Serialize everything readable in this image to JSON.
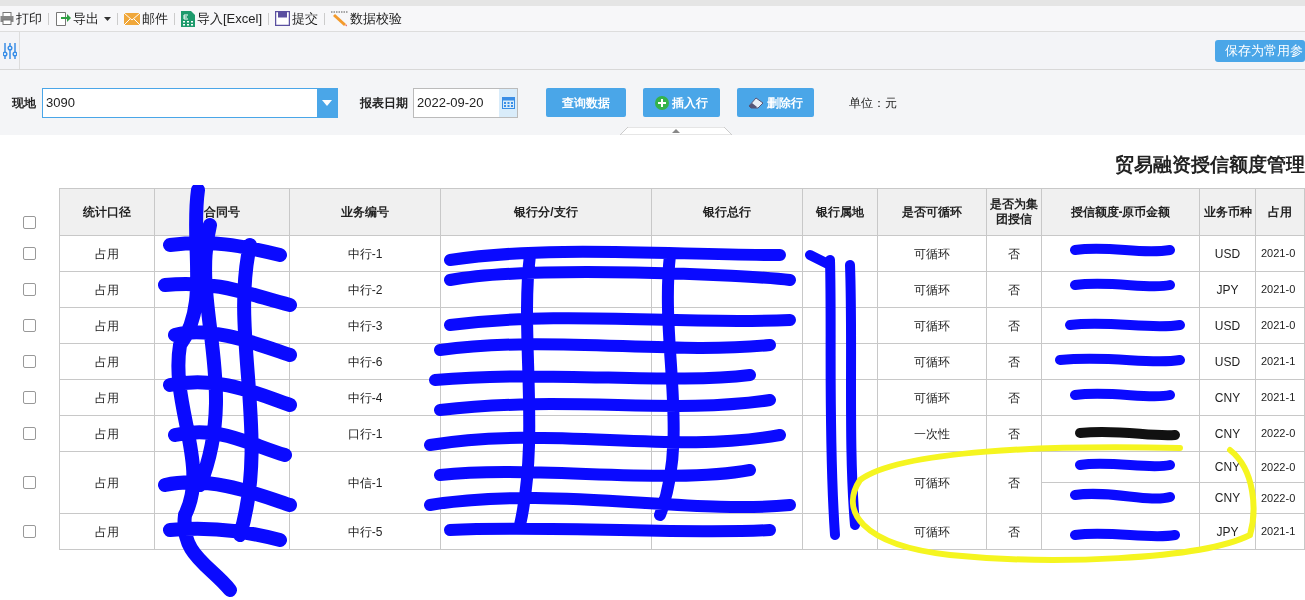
{
  "toolbar": [
    {
      "kind": "print",
      "label": "打印",
      "caret": false
    },
    {
      "kind": "export",
      "label": "导出",
      "caret": true
    },
    {
      "kind": "mail",
      "label": "邮件",
      "caret": false
    },
    {
      "kind": "excel",
      "label": "导入[Excel]",
      "caret": false
    },
    {
      "kind": "submit",
      "label": "提交",
      "caret": false
    },
    {
      "kind": "validate",
      "label": "数据校验",
      "caret": false
    }
  ],
  "save_button": "保存为常用参",
  "filters": {
    "location": {
      "label": "现地",
      "value": "3090"
    },
    "report_date": {
      "label": "报表日期",
      "value": "2022-09-20"
    },
    "buttons": [
      {
        "kind": "plain",
        "label": "查询数据"
      },
      {
        "kind": "insert",
        "label": "插入行"
      },
      {
        "kind": "delete",
        "label": "删除行"
      }
    ],
    "unit": "单位：元"
  },
  "title": "贸易融资授信额度管理",
  "table": {
    "select_all": false,
    "columns": [
      "统计口径",
      "合同号",
      "业务编号",
      "银行分/支行",
      "银行总行",
      "银行属地",
      "是否可循环",
      "是否为集团授信",
      "授信额度-原币金额",
      "业务币种",
      "占用"
    ],
    "rows": [
      {
        "checked": false,
        "scope": "占用",
        "business_no": "中行-1",
        "revolving": "可循环",
        "group": "否",
        "lines": [
          {
            "currency": "USD",
            "column_11": "2021-0"
          }
        ]
      },
      {
        "checked": false,
        "scope": "占用",
        "business_no": "中行-2",
        "revolving": "可循环",
        "group": "否",
        "lines": [
          {
            "currency": "JPY",
            "column_11": "2021-0"
          }
        ]
      },
      {
        "checked": false,
        "scope": "占用",
        "business_no": "中行-3",
        "revolving": "可循环",
        "group": "否",
        "lines": [
          {
            "currency": "USD",
            "column_11": "2021-0"
          }
        ]
      },
      {
        "checked": false,
        "scope": "占用",
        "business_no": "中行-6",
        "revolving": "可循环",
        "group": "否",
        "lines": [
          {
            "currency": "USD",
            "column_11": "2021-1"
          }
        ]
      },
      {
        "checked": false,
        "scope": "占用",
        "business_no": "中行-4",
        "revolving": "可循环",
        "group": "否",
        "lines": [
          {
            "currency": "CNY",
            "column_11": "2021-1"
          }
        ]
      },
      {
        "checked": false,
        "scope": "占用",
        "business_no": "口行-1",
        "revolving": "一次性",
        "group": "否",
        "lines": [
          {
            "currency": "CNY",
            "column_11": "2022-0"
          }
        ]
      },
      {
        "checked": false,
        "scope": "占用",
        "business_no": "中信-1",
        "revolving": "可循环",
        "group": "否",
        "lines": [
          {
            "currency": "CNY",
            "column_11": "2022-0"
          },
          {
            "currency": "CNY",
            "column_11": "2022-0"
          }
        ]
      },
      {
        "checked": false,
        "scope": "占用",
        "business_no": "中行-5",
        "revolving": "可循环",
        "group": "否",
        "lines": [
          {
            "currency": "JPY",
            "column_11": "2021-1"
          }
        ]
      }
    ]
  }
}
